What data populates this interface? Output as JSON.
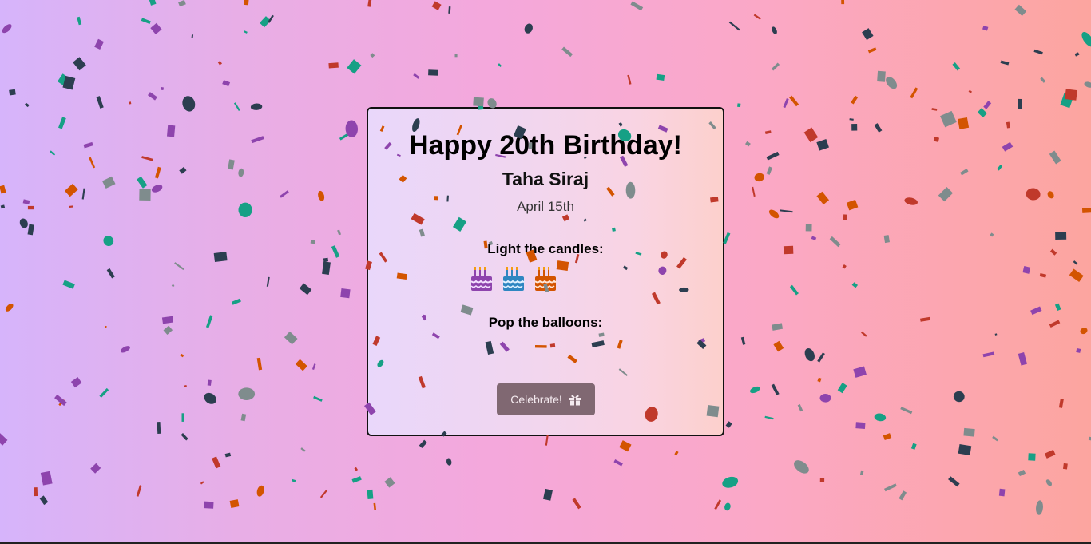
{
  "card": {
    "title": "Happy 20th Birthday!",
    "name": "Taha Siraj",
    "date": "April 15th",
    "candles_label": "Light the candles:",
    "balloons_label": "Pop the balloons:",
    "celebrate_label": "Celebrate!"
  },
  "cakes": [
    {
      "icon": "cake-icon",
      "color": "#8e44ad"
    },
    {
      "icon": "cake-icon",
      "color": "#2e86c1"
    },
    {
      "icon": "cake-icon",
      "color": "#d35400"
    }
  ],
  "colors": {
    "confetti": [
      "#8e44ad",
      "#d35400",
      "#16a085",
      "#2c3e50",
      "#c0392b",
      "#7f8c8d"
    ],
    "button_bg": "#806872",
    "gradient_start": "#d6b4fb",
    "gradient_end": "#fca59f"
  }
}
